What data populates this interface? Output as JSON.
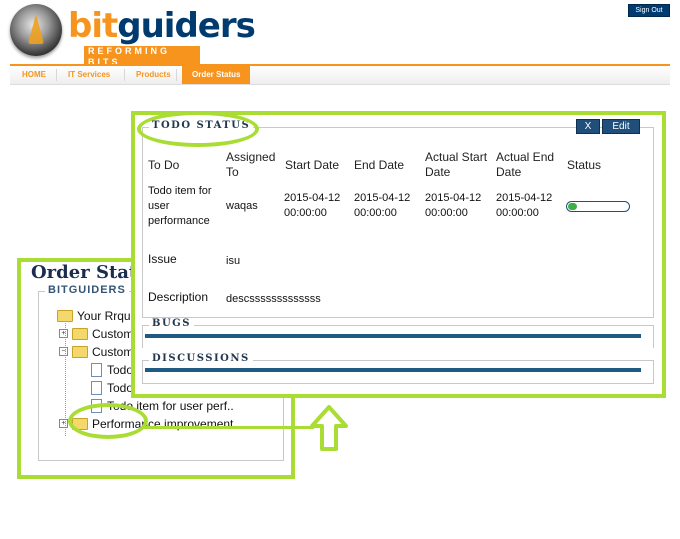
{
  "header": {
    "logo_primary": "bit",
    "logo_secondary": "guiders",
    "logo_tagline": "REFORMING BITS",
    "sign_out": "Sign Out"
  },
  "nav": {
    "items": [
      {
        "label": "HOME"
      },
      {
        "label": "IT Services"
      },
      {
        "label": "Products"
      },
      {
        "label": "Order Status"
      }
    ]
  },
  "order": {
    "title": "Order Status",
    "section": "BITGUIDERS",
    "tree": [
      {
        "label": "Your Rrque"
      },
      {
        "label": "Custom"
      },
      {
        "label": "Custom"
      },
      {
        "label": "Todo"
      },
      {
        "label": "Todo item for user perf.."
      },
      {
        "label": "Todo item for user perf.."
      },
      {
        "label": "Performance improvement.."
      }
    ]
  },
  "todo": {
    "legend": "TODO STATUS",
    "close_label": "X",
    "edit_label": "Edit",
    "headers": {
      "todo": "To Do",
      "assigned": "Assigned To",
      "start": "Start Date",
      "end": "End Date",
      "actual_start": "Actual Start Date",
      "actual_end": "Actual End Date",
      "status": "Status"
    },
    "row": {
      "todo": "Todo item for user performance",
      "assigned": "waqas",
      "start": "2015-04-12 00:00:00",
      "end": "2015-04-12 00:00:00",
      "actual_start": "2015-04-12 00:00:00",
      "actual_end": "2015-04-12 00:00:00",
      "status_progress": 0.15
    },
    "issue_label": "Issue",
    "issue_value": "isu",
    "description_label": "Description",
    "description_value": "descsssssssssssss",
    "bugs_legend": "BUGS",
    "discussions_legend": "DISCUSSIONS"
  },
  "colors": {
    "accent": "#f7941d",
    "brand": "#003b70",
    "highlight": "#aadd33",
    "progress": "#3cb043"
  }
}
